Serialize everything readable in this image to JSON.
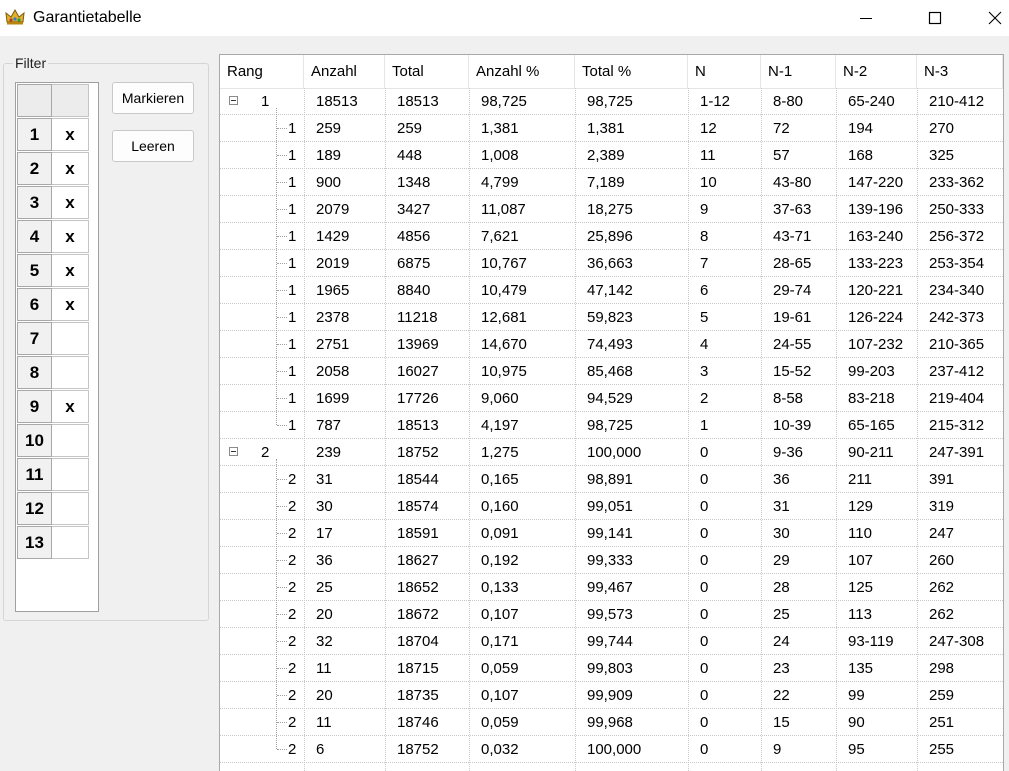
{
  "window": {
    "title": "Garantietabelle"
  },
  "filter": {
    "legend": "Filter",
    "rows": [
      {
        "num": "1",
        "val": "x"
      },
      {
        "num": "2",
        "val": "x"
      },
      {
        "num": "3",
        "val": "x"
      },
      {
        "num": "4",
        "val": "x"
      },
      {
        "num": "5",
        "val": "x"
      },
      {
        "num": "6",
        "val": "x"
      },
      {
        "num": "7",
        "val": ""
      },
      {
        "num": "8",
        "val": ""
      },
      {
        "num": "9",
        "val": "x"
      },
      {
        "num": "10",
        "val": ""
      },
      {
        "num": "11",
        "val": ""
      },
      {
        "num": "12",
        "val": ""
      },
      {
        "num": "13",
        "val": ""
      }
    ]
  },
  "buttons": {
    "mark": "Markieren",
    "clear": "Leeren"
  },
  "table": {
    "headers": [
      "Rang",
      "Anzahl",
      "Total",
      "Anzahl %",
      "Total %",
      "N",
      "N-1",
      "N-2",
      "N-3"
    ],
    "rows": [
      {
        "rang": "1",
        "parent": true,
        "cells": [
          "18513",
          "18513",
          "98,725",
          "98,725",
          "1-12",
          "8-80",
          "65-240",
          "210-412"
        ]
      },
      {
        "rang": "1",
        "cells": [
          "259",
          "259",
          "1,381",
          "1,381",
          "12",
          "72",
          "194",
          "270"
        ]
      },
      {
        "rang": "1",
        "cells": [
          "189",
          "448",
          "1,008",
          "2,389",
          "11",
          "57",
          "168",
          "325"
        ]
      },
      {
        "rang": "1",
        "cells": [
          "900",
          "1348",
          "4,799",
          "7,189",
          "10",
          "43-80",
          "147-220",
          "233-362"
        ]
      },
      {
        "rang": "1",
        "cells": [
          "2079",
          "3427",
          "11,087",
          "18,275",
          "9",
          "37-63",
          "139-196",
          "250-333"
        ]
      },
      {
        "rang": "1",
        "cells": [
          "1429",
          "4856",
          "7,621",
          "25,896",
          "8",
          "43-71",
          "163-240",
          "256-372"
        ]
      },
      {
        "rang": "1",
        "cells": [
          "2019",
          "6875",
          "10,767",
          "36,663",
          "7",
          "28-65",
          "133-223",
          "253-354"
        ]
      },
      {
        "rang": "1",
        "cells": [
          "1965",
          "8840",
          "10,479",
          "47,142",
          "6",
          "29-74",
          "120-221",
          "234-340"
        ]
      },
      {
        "rang": "1",
        "cells": [
          "2378",
          "11218",
          "12,681",
          "59,823",
          "5",
          "19-61",
          "126-224",
          "242-373"
        ]
      },
      {
        "rang": "1",
        "cells": [
          "2751",
          "13969",
          "14,670",
          "74,493",
          "4",
          "24-55",
          "107-232",
          "210-365"
        ]
      },
      {
        "rang": "1",
        "cells": [
          "2058",
          "16027",
          "10,975",
          "85,468",
          "3",
          "15-52",
          "99-203",
          "237-412"
        ]
      },
      {
        "rang": "1",
        "cells": [
          "1699",
          "17726",
          "9,060",
          "94,529",
          "2",
          "8-58",
          "83-218",
          "219-404"
        ]
      },
      {
        "rang": "1",
        "cells": [
          "787",
          "18513",
          "4,197",
          "98,725",
          "1",
          "10-39",
          "65-165",
          "215-312"
        ]
      },
      {
        "rang": "2",
        "parent": true,
        "cells": [
          "239",
          "18752",
          "1,275",
          "100,000",
          "0",
          "9-36",
          "90-211",
          "247-391"
        ]
      },
      {
        "rang": "2",
        "cells": [
          "31",
          "18544",
          "0,165",
          "98,891",
          "0",
          "36",
          "211",
          "391"
        ]
      },
      {
        "rang": "2",
        "cells": [
          "30",
          "18574",
          "0,160",
          "99,051",
          "0",
          "31",
          "129",
          "319"
        ]
      },
      {
        "rang": "2",
        "cells": [
          "17",
          "18591",
          "0,091",
          "99,141",
          "0",
          "30",
          "110",
          "247"
        ]
      },
      {
        "rang": "2",
        "cells": [
          "36",
          "18627",
          "0,192",
          "99,333",
          "0",
          "29",
          "107",
          "260"
        ]
      },
      {
        "rang": "2",
        "cells": [
          "25",
          "18652",
          "0,133",
          "99,467",
          "0",
          "28",
          "125",
          "262"
        ]
      },
      {
        "rang": "2",
        "cells": [
          "20",
          "18672",
          "0,107",
          "99,573",
          "0",
          "25",
          "113",
          "262"
        ]
      },
      {
        "rang": "2",
        "cells": [
          "32",
          "18704",
          "0,171",
          "99,744",
          "0",
          "24",
          "93-119",
          "247-308"
        ]
      },
      {
        "rang": "2",
        "cells": [
          "11",
          "18715",
          "0,059",
          "99,803",
          "0",
          "23",
          "135",
          "298"
        ]
      },
      {
        "rang": "2",
        "cells": [
          "20",
          "18735",
          "0,107",
          "99,909",
          "0",
          "22",
          "99",
          "259"
        ]
      },
      {
        "rang": "2",
        "cells": [
          "11",
          "18746",
          "0,059",
          "99,968",
          "0",
          "15",
          "90",
          "251"
        ]
      },
      {
        "rang": "2",
        "cells": [
          "6",
          "18752",
          "0,032",
          "100,000",
          "0",
          "9",
          "95",
          "255"
        ]
      }
    ]
  }
}
